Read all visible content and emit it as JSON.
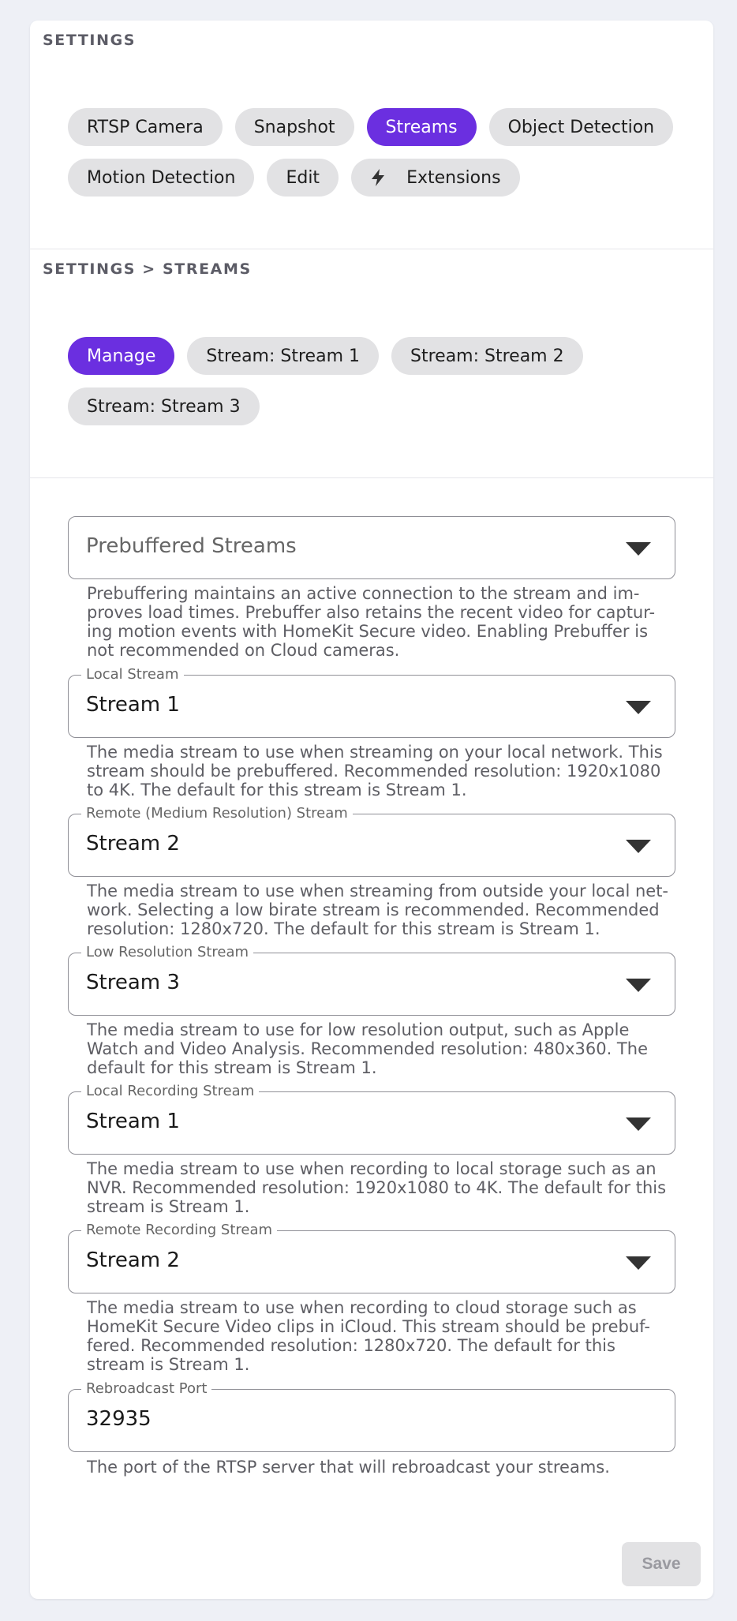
{
  "settings": {
    "title": "SETTINGS",
    "tabs": [
      {
        "label": "RTSP Camera",
        "active": false
      },
      {
        "label": "Snapshot",
        "active": false
      },
      {
        "label": "Streams",
        "active": true
      },
      {
        "label": "Object Detection",
        "active": false
      },
      {
        "label": "Motion Detection",
        "active": false
      },
      {
        "label": "Edit",
        "active": false
      },
      {
        "label": "Extensions",
        "active": false,
        "icon": "lightning-icon"
      }
    ]
  },
  "streams_section": {
    "title": "SETTINGS > STREAMS",
    "tabs": [
      {
        "label": "Manage",
        "active": true
      },
      {
        "label": "Stream: Stream 1",
        "active": false
      },
      {
        "label": "Stream: Stream 2",
        "active": false
      },
      {
        "label": "Stream: Stream 3",
        "active": false
      }
    ]
  },
  "form": {
    "prebuffered": {
      "placeholder": "Prebuffered Streams",
      "helper": "Prebuffering maintains an active connection to the stream and im-proves load times. Prebuffer also retains the recent video for captur-ing motion events with HomeKit Secure video. Enabling Prebuffer is not recommended on Cloud cameras."
    },
    "local_stream": {
      "label": "Local Stream",
      "value": "Stream 1",
      "helper": "The media stream to use when streaming on your local network. This stream should be prebuffered. Recommended resolution: 1920x1080 to 4K. The default for this stream is Stream 1."
    },
    "remote_stream": {
      "label": "Remote (Medium Resolution) Stream",
      "value": "Stream 2",
      "helper": "The media stream to use when streaming from outside your local net-work. Selecting a low birate stream is recommended. Recommended resolution: 1280x720. The default for this stream is Stream 1."
    },
    "low_res_stream": {
      "label": "Low Resolution Stream",
      "value": "Stream 3",
      "helper": "The media stream to use for low resolution output, such as Apple Watch and Video Analysis. Recommended resolution: 480x360. The default for this stream is Stream 1."
    },
    "local_recording_stream": {
      "label": "Local Recording Stream",
      "value": "Stream 1",
      "helper": "The media stream to use when recording to local storage such as an NVR. Recommended resolution: 1920x1080 to 4K. The default for this stream is Stream 1."
    },
    "remote_recording_stream": {
      "label": "Remote Recording Stream",
      "value": "Stream 2",
      "helper": "The media stream to use when recording to cloud storage such as HomeKit Secure Video clips in iCloud. This stream should be prebuf-fered. Recommended resolution: 1280x720. The default for this stream is Stream 1."
    },
    "rebroadcast_port": {
      "label": "Rebroadcast Port",
      "value": "32935",
      "helper": "The port of the RTSP server that will rebroadcast your streams."
    }
  },
  "actions": {
    "save_label": "Save"
  },
  "colors": {
    "accent": "#6b2fe0",
    "chip_bg": "#e2e2e4",
    "page_bg": "#eef0f6"
  }
}
